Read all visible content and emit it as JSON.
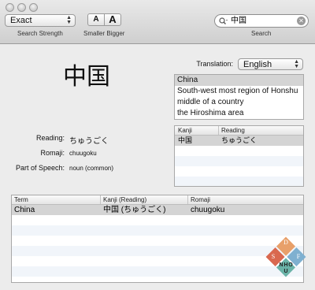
{
  "toolbar": {
    "strength_value": "Exact",
    "strength_label": "Search Strength",
    "smaller_glyph": "A",
    "bigger_glyph": "A",
    "size_label": "Smaller Bigger",
    "search_value": "中国",
    "search_label": "Search"
  },
  "entry": {
    "headword": "中国",
    "translation_label": "Translation:",
    "translation_value": "English",
    "reading_label": "Reading:",
    "reading_value": "ちゅうごく",
    "romaji_label": "Romaji:",
    "romaji_value": "chuugoku",
    "pos_label": "Part of Speech:",
    "pos_value": "noun (common)"
  },
  "definitions": [
    "China",
    "South-west most region of Honshu",
    "middle of a country",
    "the Hiroshima area"
  ],
  "readings_table": {
    "headers": [
      "Kanji",
      "Reading"
    ],
    "rows": [
      [
        "中国",
        "ちゅうごく"
      ]
    ]
  },
  "results_table": {
    "headers": [
      "Term",
      "Kanji (Reading)",
      "Romaji"
    ],
    "rows": [
      [
        "China",
        "中国 (ちゅうごく)",
        "chuugoku"
      ]
    ]
  },
  "logo": {
    "letters": [
      "D",
      "S",
      "F",
      "N",
      "H",
      "O",
      "U"
    ],
    "colors": [
      "#e8a06a",
      "#d9684f",
      "#6ab3a8",
      "#7fb0d0"
    ]
  }
}
